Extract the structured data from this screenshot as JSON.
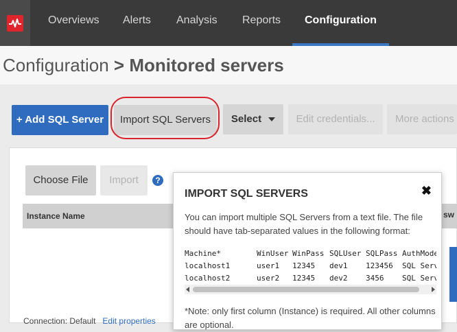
{
  "nav": {
    "logo_icon": "heartbeat-logo-icon",
    "tabs": [
      {
        "label": "Overviews"
      },
      {
        "label": "Alerts"
      },
      {
        "label": "Analysis"
      },
      {
        "label": "Reports"
      },
      {
        "label": "Configuration",
        "active": true
      }
    ]
  },
  "page": {
    "breadcrumb_parent": "Configuration",
    "breadcrumb_sep": ">",
    "breadcrumb_current": "Monitored servers"
  },
  "toolbar": {
    "add_label": "+ Add SQL Server",
    "import_label": "Import SQL Servers",
    "select_label": "Select",
    "edit_credentials_label": "Edit credentials...",
    "more_actions_label": "More actions"
  },
  "panel": {
    "choose_file_label": "Choose File",
    "import_label": "Import",
    "help_icon": "help-icon",
    "table_header_instance": "Instance Name",
    "table_header_partial": "sw",
    "footer_text": "Connection: Default",
    "footer_link": "Edit properties"
  },
  "modal": {
    "title": "IMPORT SQL SERVERS",
    "description": "You can import multiple SQL Servers from a text file. The file should have tab-separated values in the following format:",
    "columns": [
      "Machine*",
      "WinUser",
      "WinPass",
      "SQLUser",
      "SQLPass",
      "AuthMode"
    ],
    "rows": [
      [
        "localhost1",
        "user1",
        "12345",
        "dev1",
        "123456",
        "SQL Serv"
      ],
      [
        "localhost2",
        "user2",
        "12345",
        "dev2",
        "3456",
        "SQL Serv"
      ]
    ],
    "note": "*Note: only first column (Instance) is required. All other columns are optional."
  },
  "colors": {
    "nav_bg": "#3a3a3a",
    "accent_blue": "#2f6cbf",
    "highlight_red": "#d9232a",
    "logo_red": "#e0242b"
  }
}
